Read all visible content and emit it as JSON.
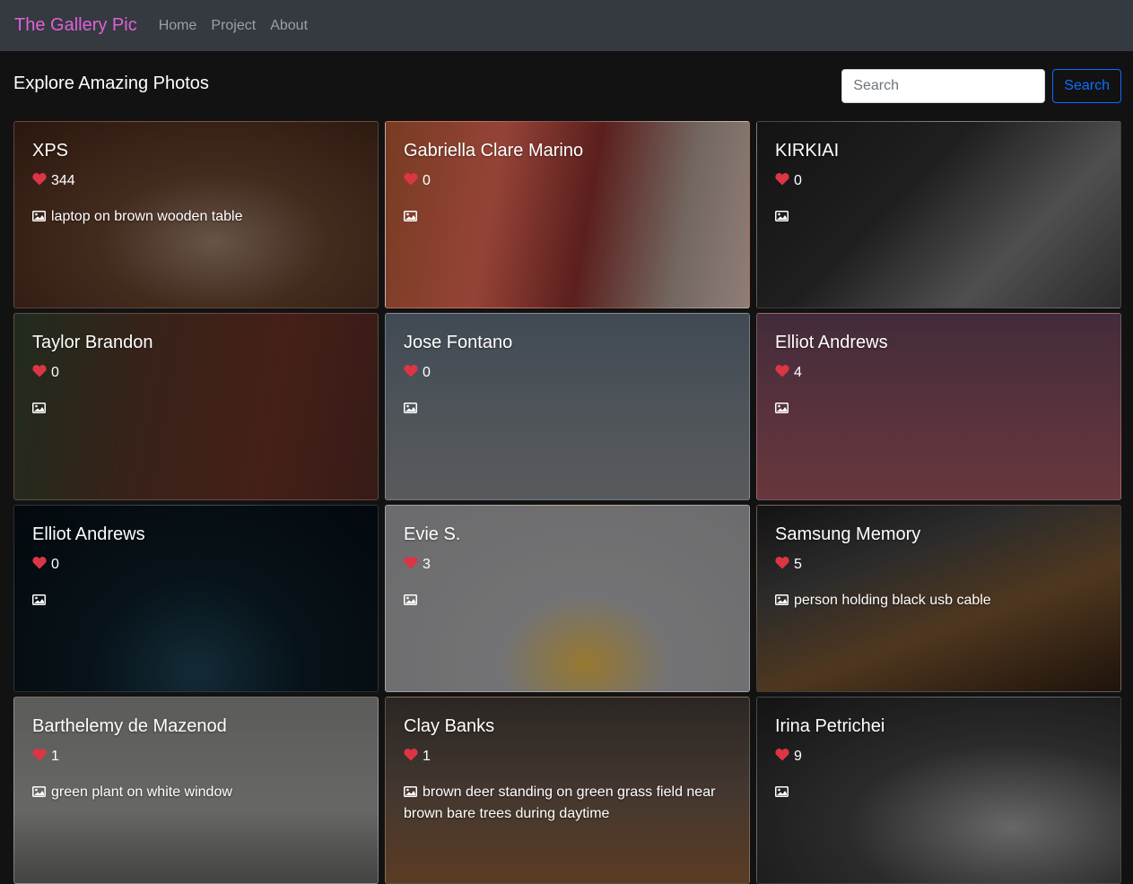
{
  "navbar": {
    "brand": "The Gallery Pic",
    "links": [
      "Home",
      "Project",
      "About"
    ]
  },
  "header": {
    "title": "Explore Amazing Photos",
    "search_placeholder": "Search",
    "search_button": "Search"
  },
  "colors": {
    "brand": "#e060d8",
    "heart": "#dc3545",
    "search_button": "#0d6efd"
  },
  "icons": {
    "like": "heart-icon",
    "description": "image-icon"
  },
  "cards": [
    {
      "title": "XPS",
      "likes": "344",
      "description": "laptop on brown wooden table"
    },
    {
      "title": "Gabriella Clare Marino",
      "likes": "0",
      "description": ""
    },
    {
      "title": "KIRKIAI",
      "likes": "0",
      "description": ""
    },
    {
      "title": "Taylor Brandon",
      "likes": "0",
      "description": ""
    },
    {
      "title": "Jose Fontano",
      "likes": "0",
      "description": ""
    },
    {
      "title": "Elliot Andrews",
      "likes": "4",
      "description": ""
    },
    {
      "title": "Elliot Andrews",
      "likes": "0",
      "description": ""
    },
    {
      "title": "Evie S.",
      "likes": "3",
      "description": ""
    },
    {
      "title": "Samsung Memory",
      "likes": "5",
      "description": "person holding black usb cable"
    },
    {
      "title": "Barthelemy de Mazenod",
      "likes": "1",
      "description": "green plant on white window"
    },
    {
      "title": "Clay Banks",
      "likes": "1",
      "description": "brown deer standing on green grass field near brown bare trees during daytime"
    },
    {
      "title": "Irina Petrichei",
      "likes": "9",
      "description": ""
    }
  ]
}
